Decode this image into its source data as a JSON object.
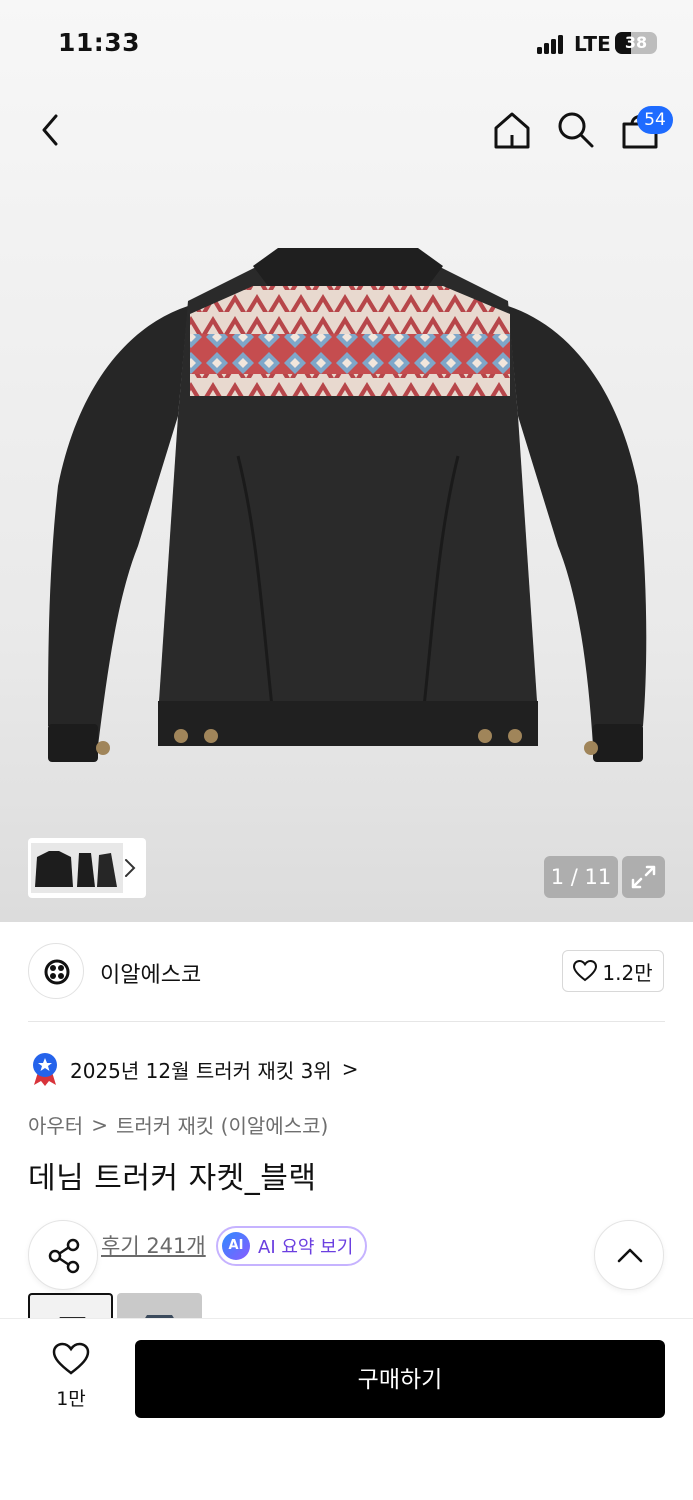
{
  "status_bar": {
    "time": "11:33",
    "network": "LTE",
    "battery": "38",
    "battery_level": 0.38
  },
  "nav": {
    "cart_count": "54",
    "icons": [
      "back-icon",
      "home-icon",
      "search-icon",
      "cart-icon"
    ]
  },
  "gallery": {
    "counter": "1 / 11",
    "thumbnail_arrow": "chevron-right-icon",
    "expand_icon": "expand-icon"
  },
  "brand": {
    "name": "이알에스코",
    "likes": "1.2만"
  },
  "ranking": {
    "text": "2025년 12월 트러커 재킷 3위",
    "chevron": ">"
  },
  "breadcrumb": {
    "category": "아우터",
    "separator": ">",
    "subcategory": "트러커 재킷 (이알에스코)"
  },
  "product": {
    "title": "데님 트러커 자켓_블랙"
  },
  "reviews": {
    "link": "후기 241개",
    "ai_badge": "AI",
    "ai_summary": "AI 요약 보기"
  },
  "bottom": {
    "wish_count": "1만",
    "buy_label": "구매하기"
  },
  "colors": {
    "accent_blue": "#1e6bff",
    "ai_purple": "#6b3fe0",
    "button_black": "#000000"
  }
}
